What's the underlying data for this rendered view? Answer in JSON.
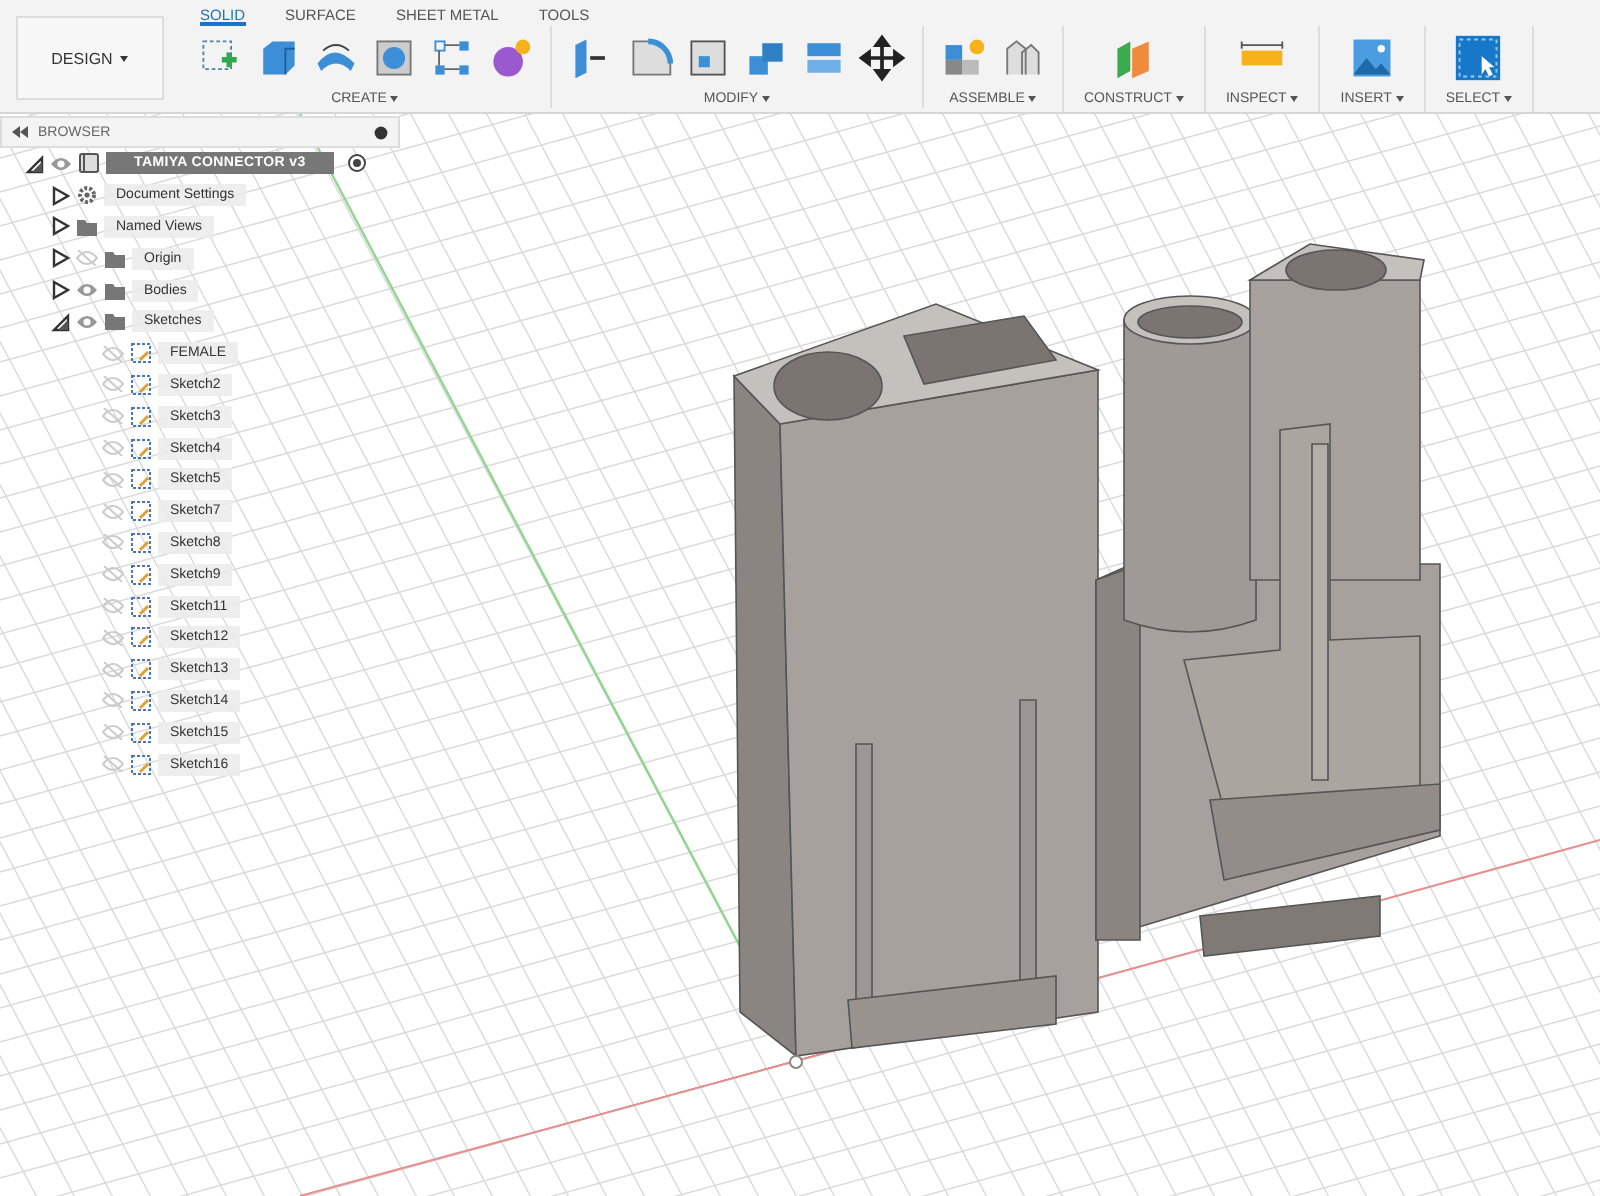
{
  "workspace": {
    "label": "DESIGN"
  },
  "tabs": [
    {
      "label": "SOLID",
      "selected": true
    },
    {
      "label": "SURFACE",
      "selected": false
    },
    {
      "label": "SHEET METAL",
      "selected": false
    },
    {
      "label": "TOOLS",
      "selected": false
    }
  ],
  "groups": [
    {
      "label": "CREATE"
    },
    {
      "label": "MODIFY"
    },
    {
      "label": "ASSEMBLE"
    },
    {
      "label": "CONSTRUCT"
    },
    {
      "label": "INSPECT"
    },
    {
      "label": "INSERT"
    },
    {
      "label": "SELECT"
    }
  ],
  "browser": {
    "title": "BROWSER",
    "tree": {
      "label": "TAMIYA CONNECTOR v3",
      "kind": "component",
      "expanded": true,
      "visible": true,
      "children": [
        {
          "label": "Document Settings",
          "kind": "settings",
          "expanded": false
        },
        {
          "label": "Named Views",
          "kind": "views",
          "expanded": false
        },
        {
          "label": "Origin",
          "kind": "folder",
          "expanded": false,
          "visible": false
        },
        {
          "label": "Bodies",
          "kind": "folder",
          "expanded": false,
          "visible": true
        },
        {
          "label": "Sketches",
          "kind": "folder",
          "expanded": true,
          "visible": true,
          "children": [
            {
              "label": "FEMALE",
              "kind": "sketch",
              "visible": false
            },
            {
              "label": "Sketch2",
              "kind": "sketch",
              "visible": false
            },
            {
              "label": "Sketch3",
              "kind": "sketch",
              "visible": false
            },
            {
              "label": "Sketch4",
              "kind": "sketch",
              "visible": false
            },
            {
              "label": "Sketch5",
              "kind": "sketch",
              "visible": false
            },
            {
              "label": "Sketch7",
              "kind": "sketch",
              "visible": false
            },
            {
              "label": "Sketch8",
              "kind": "sketch",
              "visible": false
            },
            {
              "label": "Sketch9",
              "kind": "sketch",
              "visible": false
            },
            {
              "label": "Sketch11",
              "kind": "sketch",
              "visible": false
            },
            {
              "label": "Sketch12",
              "kind": "sketch",
              "visible": false
            },
            {
              "label": "Sketch13",
              "kind": "sketch",
              "visible": false
            },
            {
              "label": "Sketch14",
              "kind": "sketch",
              "visible": false
            },
            {
              "label": "Sketch15",
              "kind": "sketch",
              "visible": false
            },
            {
              "label": "Sketch16",
              "kind": "sketch",
              "visible": false
            }
          ]
        }
      ]
    }
  }
}
